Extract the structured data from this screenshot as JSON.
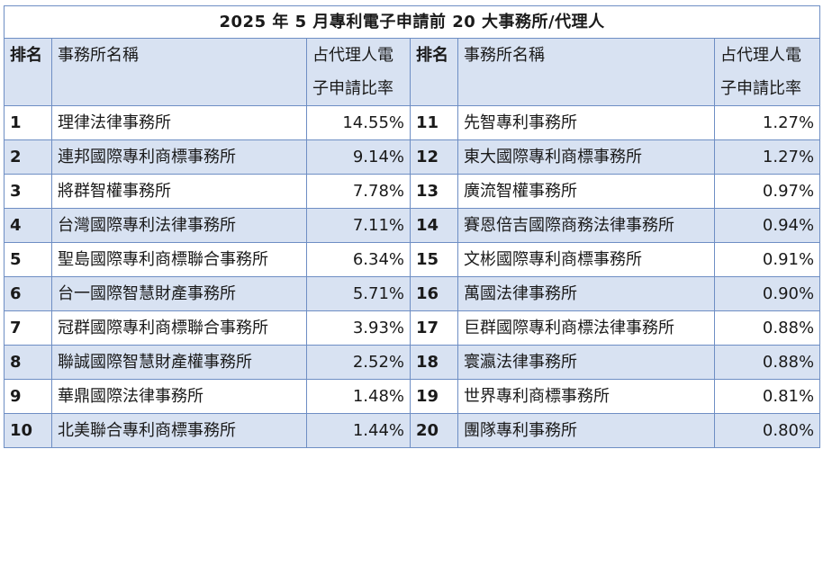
{
  "title": "2025 年 5 月專利電子申請前 20 大事務所/代理人",
  "header": {
    "rank": "排名",
    "firm": "事務所名稱",
    "share": "占代理人電子申請比率"
  },
  "rows": [
    {
      "left": {
        "rank": "1",
        "firm": "理律法律事務所",
        "pct": "14.55%"
      },
      "right": {
        "rank": "11",
        "firm": "先智專利事務所",
        "pct": "1.27%"
      }
    },
    {
      "left": {
        "rank": "2",
        "firm": "連邦國際專利商標事務所",
        "pct": "9.14%"
      },
      "right": {
        "rank": "12",
        "firm": "東大國際專利商標事務所",
        "pct": "1.27%"
      }
    },
    {
      "left": {
        "rank": "3",
        "firm": "將群智權事務所",
        "pct": "7.78%"
      },
      "right": {
        "rank": "13",
        "firm": "廣流智權事務所",
        "pct": "0.97%"
      }
    },
    {
      "left": {
        "rank": "4",
        "firm": "台灣國際專利法律事務所",
        "pct": "7.11%"
      },
      "right": {
        "rank": "14",
        "firm": "賽恩倍吉國際商務法律事務所",
        "pct": "0.94%"
      }
    },
    {
      "left": {
        "rank": "5",
        "firm": "聖島國際專利商標聯合事務所",
        "pct": "6.34%"
      },
      "right": {
        "rank": "15",
        "firm": "文彬國際專利商標事務所",
        "pct": "0.91%"
      }
    },
    {
      "left": {
        "rank": "6",
        "firm": "台一國際智慧財產事務所",
        "pct": "5.71%"
      },
      "right": {
        "rank": "16",
        "firm": "萬國法律事務所",
        "pct": "0.90%"
      }
    },
    {
      "left": {
        "rank": "7",
        "firm": "冠群國際專利商標聯合事務所",
        "pct": "3.93%"
      },
      "right": {
        "rank": "17",
        "firm": "巨群國際專利商標法律事務所",
        "pct": "0.88%"
      }
    },
    {
      "left": {
        "rank": "8",
        "firm": "聯誠國際智慧財產權事務所",
        "pct": "2.52%"
      },
      "right": {
        "rank": "18",
        "firm": "寰瀛法律事務所",
        "pct": "0.88%"
      }
    },
    {
      "left": {
        "rank": "9",
        "firm": "華鼎國際法律事務所",
        "pct": "1.48%"
      },
      "right": {
        "rank": "19",
        "firm": "世界專利商標事務所",
        "pct": "0.81%"
      }
    },
    {
      "left": {
        "rank": "10",
        "firm": "北美聯合專利商標事務所",
        "pct": "1.44%"
      },
      "right": {
        "rank": "20",
        "firm": "團隊專利事務所",
        "pct": "0.80%"
      }
    }
  ],
  "colors": {
    "band": "#d8e2f2",
    "border": "#6e8ec4",
    "rank_text": "#c00000"
  }
}
